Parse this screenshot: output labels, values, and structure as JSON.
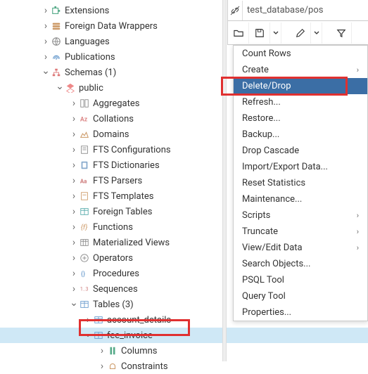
{
  "pathbar": {
    "value": "test_database/pos"
  },
  "tree": {
    "extensions": "Extensions",
    "fdw": "Foreign Data Wrappers",
    "languages": "Languages",
    "publications": "Publications",
    "schemas": "Schemas (1)",
    "public": "public",
    "aggregates": "Aggregates",
    "collations": "Collations",
    "domains": "Domains",
    "fts_conf": "FTS Configurations",
    "fts_dict": "FTS Dictionaries",
    "fts_parsers": "FTS Parsers",
    "fts_templates": "FTS Templates",
    "foreign_tables": "Foreign Tables",
    "functions": "Functions",
    "mat_views": "Materialized Views",
    "operators": "Operators",
    "procedures": "Procedures",
    "sequences": "Sequences",
    "tables": "Tables (3)",
    "account_details": "account_details",
    "fee_invoice": "fee_invoice",
    "columns": "Columns",
    "constraints": "Constraints"
  },
  "menu": {
    "count_rows": "Count Rows",
    "create": "Create",
    "delete_drop": "Delete/Drop",
    "refresh": "Refresh...",
    "restore": "Restore...",
    "backup": "Backup...",
    "drop_cascade": "Drop Cascade",
    "import_export": "Import/Export Data...",
    "reset_stats": "Reset Statistics",
    "maintenance": "Maintenance...",
    "scripts": "Scripts",
    "truncate": "Truncate",
    "view_edit": "View/Edit Data",
    "search_objects": "Search Objects...",
    "psql": "PSQL Tool",
    "query_tool": "Query Tool",
    "properties": "Properties..."
  },
  "colors": {
    "accent": "#3b6ea5",
    "highlight_box": "#e03030",
    "selection": "#cfe8f6"
  }
}
